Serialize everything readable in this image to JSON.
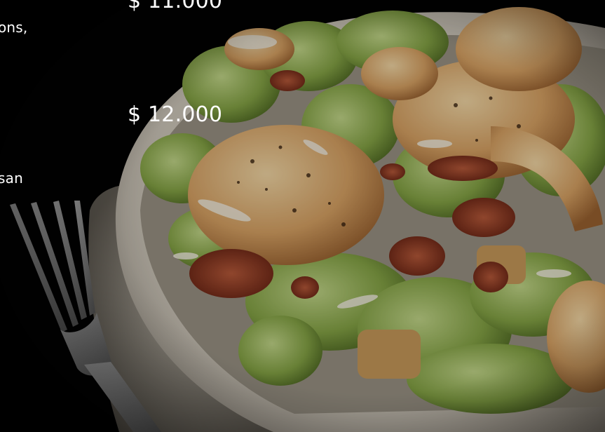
{
  "menu": {
    "items": [
      {
        "price": "$ 11.000"
      },
      {
        "price": "$ 12.000"
      }
    ],
    "description_fragments": [
      "ons,",
      "san"
    ]
  },
  "photo": {
    "subject": "shrimp-caesar-salad-bowl-with-fork",
    "colors": {
      "background": "#020202",
      "bowl": "#d8d2c6",
      "lettuce": "#7f9a3c",
      "shrimp": "#d8a066",
      "bacon": "#8c3a22",
      "fork": "#9a9a9a"
    }
  }
}
